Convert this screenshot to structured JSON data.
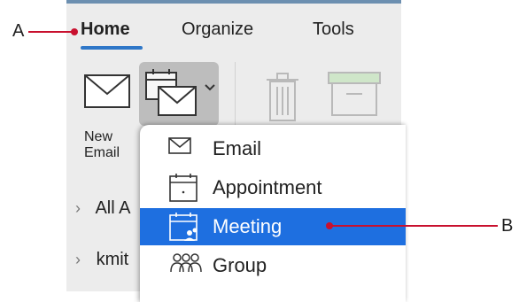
{
  "tabs": [
    {
      "label": "Home",
      "active": true
    },
    {
      "label": "Organize",
      "active": false
    },
    {
      "label": "Tools",
      "active": false
    }
  ],
  "ribbon": {
    "new_email_label_line1": "New",
    "new_email_label_line2": "Email",
    "new_items_icon": "new-items-calendar-mail-icon",
    "delete_icon": "trash-icon",
    "archive_icon": "archive-icon"
  },
  "folders": [
    {
      "label": "All A"
    },
    {
      "label": "kmit"
    }
  ],
  "new_items_menu": {
    "items": [
      {
        "label": "Email",
        "icon": "envelope-icon",
        "selected": false
      },
      {
        "label": "Appointment",
        "icon": "calendar-icon",
        "selected": false
      },
      {
        "label": "Meeting",
        "icon": "meeting-icon",
        "selected": true
      },
      {
        "label": "Group",
        "icon": "group-icon",
        "selected": false
      }
    ]
  },
  "callouts": {
    "a": "A",
    "b": "B"
  },
  "colors": {
    "accent": "#2f77c8",
    "selection": "#1e6fe0",
    "callout": "#c8102e"
  }
}
